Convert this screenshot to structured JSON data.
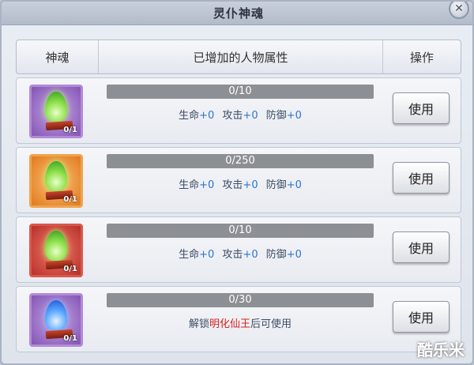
{
  "window": {
    "title": "灵仆神魂",
    "close_symbol": "✕"
  },
  "table": {
    "headers": [
      "神魂",
      "已增加的人物属性",
      "操作"
    ],
    "rows": [
      {
        "icon": "green-flame-icon",
        "frame_color": "#8354b3",
        "count": "0/1",
        "progress_text": "0/10",
        "progress_fraction": 0,
        "stats": [
          {
            "label": "生命",
            "value": "+0"
          },
          {
            "label": "攻击",
            "value": "+0"
          },
          {
            "label": "防御",
            "value": "+0"
          }
        ],
        "action": "使用"
      },
      {
        "icon": "green-flame-icon",
        "frame_color": "#e07a1e",
        "count": "0/1",
        "progress_text": "0/250",
        "progress_fraction": 0,
        "stats": [
          {
            "label": "生命",
            "value": "+0"
          },
          {
            "label": "攻击",
            "value": "+0"
          },
          {
            "label": "防御",
            "value": "+0"
          }
        ],
        "action": "使用"
      },
      {
        "icon": "green-flame-icon",
        "frame_color": "#b8302a",
        "count": "0/1",
        "progress_text": "0/10",
        "progress_fraction": 0,
        "stats": [
          {
            "label": "生命",
            "value": "+0"
          },
          {
            "label": "攻击",
            "value": "+0"
          },
          {
            "label": "防御",
            "value": "+0"
          }
        ],
        "action": "使用"
      },
      {
        "icon": "blue-flame-icon",
        "frame_color": "#8354b3",
        "count": "0/1",
        "progress_text": "0/30",
        "progress_fraction": 0,
        "unlock": {
          "prefix": "解锁",
          "name": "明化仙王",
          "suffix": "后可使用"
        },
        "action": "使用"
      }
    ]
  },
  "watermark": "酷乐米"
}
